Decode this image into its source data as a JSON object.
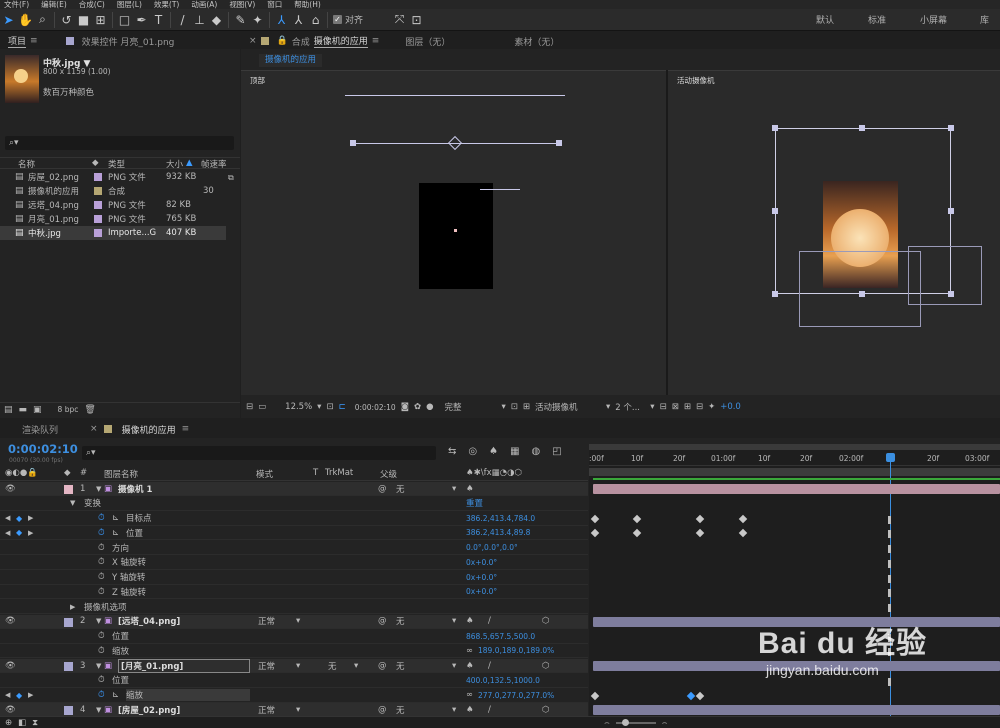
{
  "menu": [
    "文件(F)",
    "编辑(E)",
    "合成(C)",
    "图层(L)",
    "效果(T)",
    "动画(A)",
    "视图(V)",
    "窗口",
    "帮助(H)"
  ],
  "toolbar": {
    "snap_label": "对齐",
    "workspaces": [
      "默认",
      "标准",
      "小屏幕",
      "库"
    ]
  },
  "project": {
    "tab": "项目",
    "effects_tab": "效果控件 月亮_01.png",
    "asset_name": "中秋.jpg ▼",
    "asset_dims": "800 x 1159 (1.00)",
    "asset_colors": "数百万种颜色",
    "search_placeholder": "",
    "col_name": "名称",
    "col_type": "类型",
    "col_size": "大小",
    "col_fps": "帧速率",
    "items": [
      {
        "name": "房屋_02.png",
        "type": "PNG 文件",
        "size": "932 KB",
        "fps": "",
        "color": "#b9a0d8"
      },
      {
        "name": "摄像机的应用",
        "type": "合成",
        "size": "",
        "fps": "30",
        "color": "#b5a773"
      },
      {
        "name": "远塔_04.png",
        "type": "PNG 文件",
        "size": "82 KB",
        "fps": "",
        "color": "#b9a0d8"
      },
      {
        "name": "月亮_01.png",
        "type": "PNG 文件",
        "size": "765 KB",
        "fps": "",
        "color": "#b9a0d8"
      },
      {
        "name": "中秋.jpg",
        "type": "Importe...G",
        "size": "407 KB",
        "fps": "",
        "color": "#b9a0d8"
      }
    ],
    "bpc": "8 bpc"
  },
  "comp": {
    "tab_comp": "合成",
    "tab_name": "摄像机的应用",
    "tab_layer": "图层（无）",
    "tab_footage": "素材（无）",
    "subtab": "摄像机的应用",
    "view_left": "顶部",
    "view_right": "活动摄像机",
    "zoom": "12.5%",
    "time": "0:00:02:10",
    "resolution": "完整",
    "camera": "活动摄像机",
    "views": "2 个...",
    "exposure": "+0.0"
  },
  "timeline": {
    "tab_render": "渲染队列",
    "tab_comp": "摄像机的应用",
    "timecode": "0:00:02:10",
    "fps_info": "00070 (30.00 fps)",
    "col_name": "图层名称",
    "col_mode": "模式",
    "col_t": "T",
    "col_trkmat": "TrkMat",
    "col_parent": "父级",
    "ruler": [
      ":00f",
      "10f",
      "20f",
      "01:00f",
      "10f",
      "20f",
      "02:00f",
      "",
      "20f",
      "03:00f"
    ],
    "rows": [
      {
        "num": "1",
        "label": "摄像机 1",
        "value": "",
        "kind": "layer",
        "color": "#e4b6c4",
        "mode": "",
        "parent": "无"
      },
      {
        "num": "",
        "label": "变换",
        "value": "重置",
        "kind": "group"
      },
      {
        "num": "",
        "label": "目标点",
        "value": "386.2,413.4,784.0",
        "kind": "prop"
      },
      {
        "num": "",
        "label": "位置",
        "value": "386.2,413.4,89.8",
        "kind": "prop"
      },
      {
        "num": "",
        "label": "方向",
        "value": "0.0°,0.0°,0.0°",
        "kind": "prop"
      },
      {
        "num": "",
        "label": "X 轴旋转",
        "value": "0x+0.0°",
        "kind": "prop"
      },
      {
        "num": "",
        "label": "Y 轴旋转",
        "value": "0x+0.0°",
        "kind": "prop"
      },
      {
        "num": "",
        "label": "Z 轴旋转",
        "value": "0x+0.0°",
        "kind": "prop"
      },
      {
        "num": "",
        "label": "摄像机选项",
        "value": "",
        "kind": "group"
      },
      {
        "num": "2",
        "label": "[远塔_04.png]",
        "value": "",
        "kind": "layer",
        "color": "#a7a6cf",
        "mode": "正常",
        "parent": "无"
      },
      {
        "num": "",
        "label": "位置",
        "value": "868.5,657.5,500.0",
        "kind": "prop"
      },
      {
        "num": "",
        "label": "缩放",
        "value": "189.0,189.0,189.0%",
        "kind": "prop"
      },
      {
        "num": "3",
        "label": "[月亮_01.png]",
        "value": "",
        "kind": "layer",
        "color": "#a7a6cf",
        "mode": "正常",
        "trkmat": "无",
        "parent": "无"
      },
      {
        "num": "",
        "label": "位置",
        "value": "400.0,132.5,1000.0",
        "kind": "prop"
      },
      {
        "num": "",
        "label": "缩放",
        "value": "277.0,277.0,277.0%",
        "kind": "prop"
      },
      {
        "num": "4",
        "label": "[房屋_02.png]",
        "value": "",
        "kind": "layer",
        "color": "#a7a6cf",
        "mode": "正常",
        "parent": "无"
      }
    ]
  },
  "watermark": {
    "brand": "Bai du 经验",
    "url": "jingyan.baidu.com"
  }
}
